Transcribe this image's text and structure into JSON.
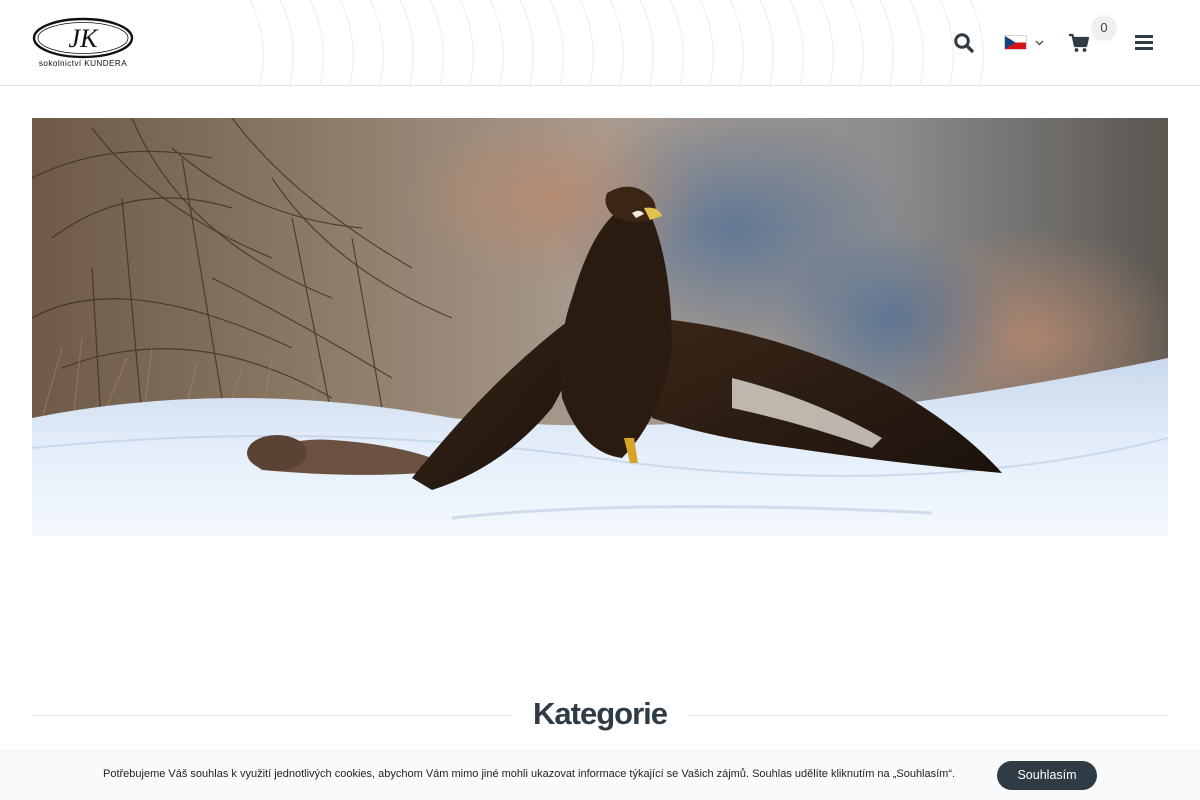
{
  "header": {
    "logo_monogram": "JK",
    "logo_text": "sokolnictví KUNDERA",
    "icons": {
      "search": "search-icon",
      "language": "czech-flag-icon",
      "language_chevron": "chevron-down-icon",
      "cart": "shopping-cart-icon",
      "menu": "hamburger-menu-icon"
    },
    "cart_count": "0"
  },
  "hero": {
    "image": "golden-eagle-on-snow-with-prey"
  },
  "section": {
    "title": "Kategorie"
  },
  "cookie_bar": {
    "text": "Potřebujeme Váš souhlas k využití jednotlivých cookies, abychom Vám mimo jiné mohli ukazovat informace týkající se Vašich zájmů. Souhlas udělíte kliknutím na „Souhlasím“.",
    "accept_label": "Souhlasím"
  },
  "colors": {
    "dark_accent": "#2f3b45",
    "header_border": "#e3e3e3",
    "badge_bg": "#efefef"
  }
}
